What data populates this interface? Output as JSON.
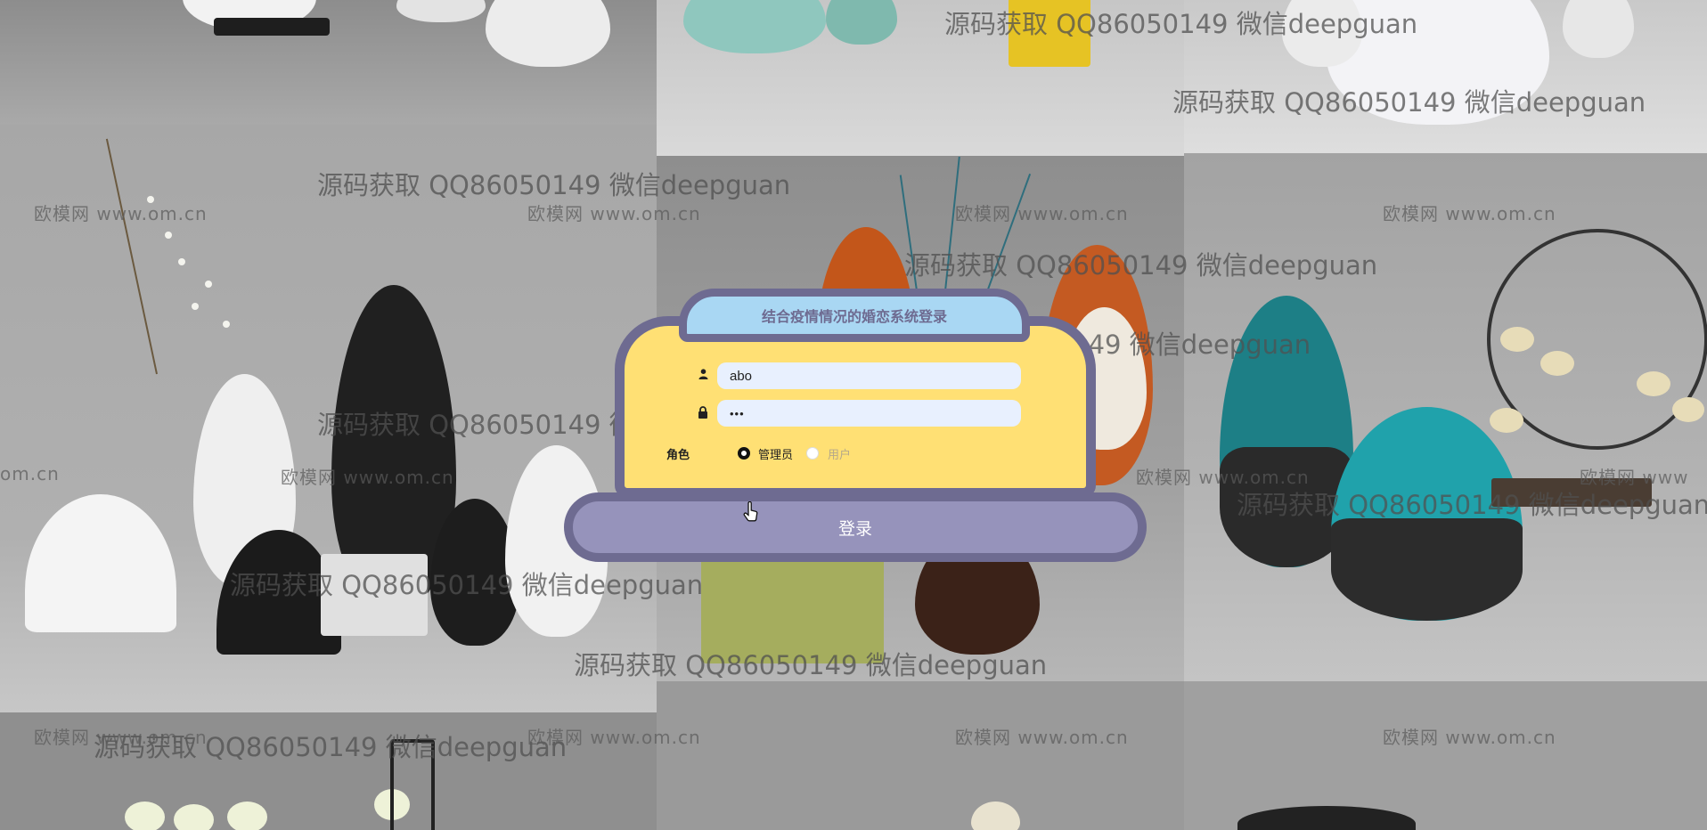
{
  "login": {
    "title": "结合疫情情况的婚恋系统登录",
    "username_value": "abo",
    "password_mask": "•••",
    "role_label": "角色",
    "roles": [
      "管理员",
      "用户"
    ],
    "selected_role": "管理员",
    "submit_label": "登录"
  },
  "watermarks": {
    "contact": "源码获取 QQ86050149 微信deepguan",
    "site": "欧模网 www.om.cn",
    "site_fragment": "om.cn",
    "site_edge": "欧模网 www"
  },
  "colors": {
    "panel_fill": "#ffe074",
    "panel_border": "#6e6b91",
    "title_fill": "#a9d7f3",
    "button_fill": "#9693bb",
    "input_fill": "#e8f0fe"
  },
  "icons": {
    "username": "user-icon",
    "password": "lock-icon",
    "cursor": "hand-pointer-icon"
  }
}
